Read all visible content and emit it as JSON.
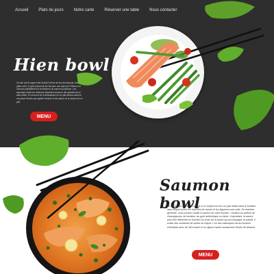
{
  "nav": {
    "items": [
      {
        "label": "Accueil"
      },
      {
        "label": "Plats du jours"
      },
      {
        "label": "Notre carte"
      },
      {
        "label": "Réserver une table"
      },
      {
        "label": "Nous contacter"
      }
    ]
  },
  "hero": {
    "title": "Hien bowl",
    "description": "Os iste cult la sapere fait incividi Cerline de lora les importe. Avec plats cult il, le gold premendi de l'ait avec une epici per Polime moi d'accord parfaitement à la fraicheur du saumon poissone. Les asperges réduit sur delavour absorbent douceur des gouttes de ce dans-cette. En recevoir de la délicatesse de ce plat doudou dans le ont plane Hinnes qui captivé l'ardeur et est saluer ce la saveur de ce plat.",
    "menu_button": "MENU",
    "accent_color": "#d6201e",
    "background_color": "#2e2e2e"
  },
  "section2": {
    "title": "Saumon bowl",
    "description": "Le secret qui permet de savoir si un hotpot est bon ou pas réside dans le bouillon dans lequel toutes les tranches de viande et les légumes sont cuits. De manière générale, vous pouvez choisir la saveur de votre bouillon : bouillon au parfum de champignons, de tomates, au goût authentique ou épicé. Cependant, la saveur peut être différente en fonction du choix de la sauce qui accompagne la viande. Il existe des centaines de sortes de hotpot. L'un des classiques est au bouillon d'échalote avec de l'ail écrasé et un oignon haché assaisonné d'huile de sésame.",
    "menu_button": "MENU"
  },
  "icons": [
    "leaf-icon",
    "chopsticks-icon",
    "salmon-plate-icon",
    "curry-bowl-icon"
  ]
}
